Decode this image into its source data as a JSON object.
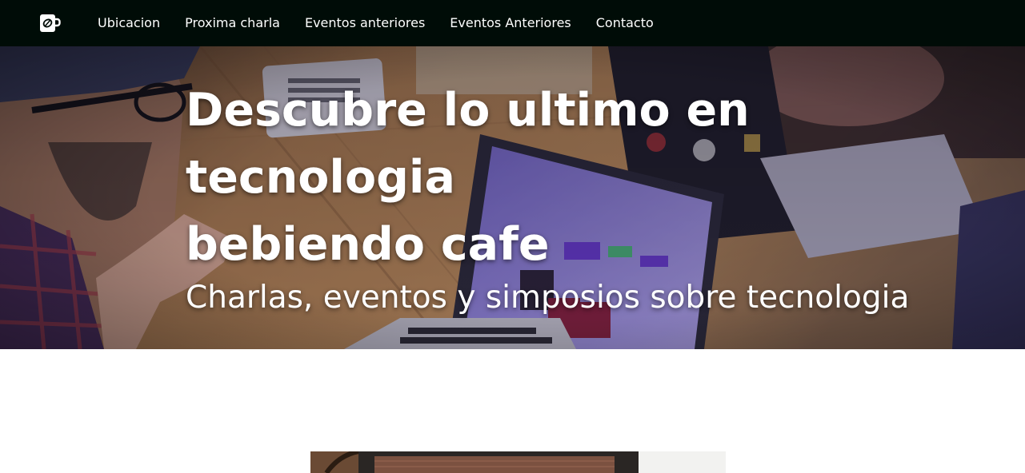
{
  "nav": {
    "brand_icon": "coffee-cup-leaf-icon",
    "links": [
      {
        "label": "Ubicacion"
      },
      {
        "label": "Proxima charla"
      },
      {
        "label": "Eventos anteriores"
      },
      {
        "label": "Eventos Anteriores"
      },
      {
        "label": "Contacto"
      }
    ]
  },
  "hero": {
    "title_line1": "Descubre lo ultimo en tecnologia",
    "title_line2": "bebiendo cafe",
    "subtitle": "Charlas, eventos y simposios sobre tecnologia"
  },
  "colors": {
    "navbar_bg": "#000c07",
    "nav_text": "#ffffff",
    "hero_text": "#ffffff",
    "page_bg": "#ffffff"
  }
}
